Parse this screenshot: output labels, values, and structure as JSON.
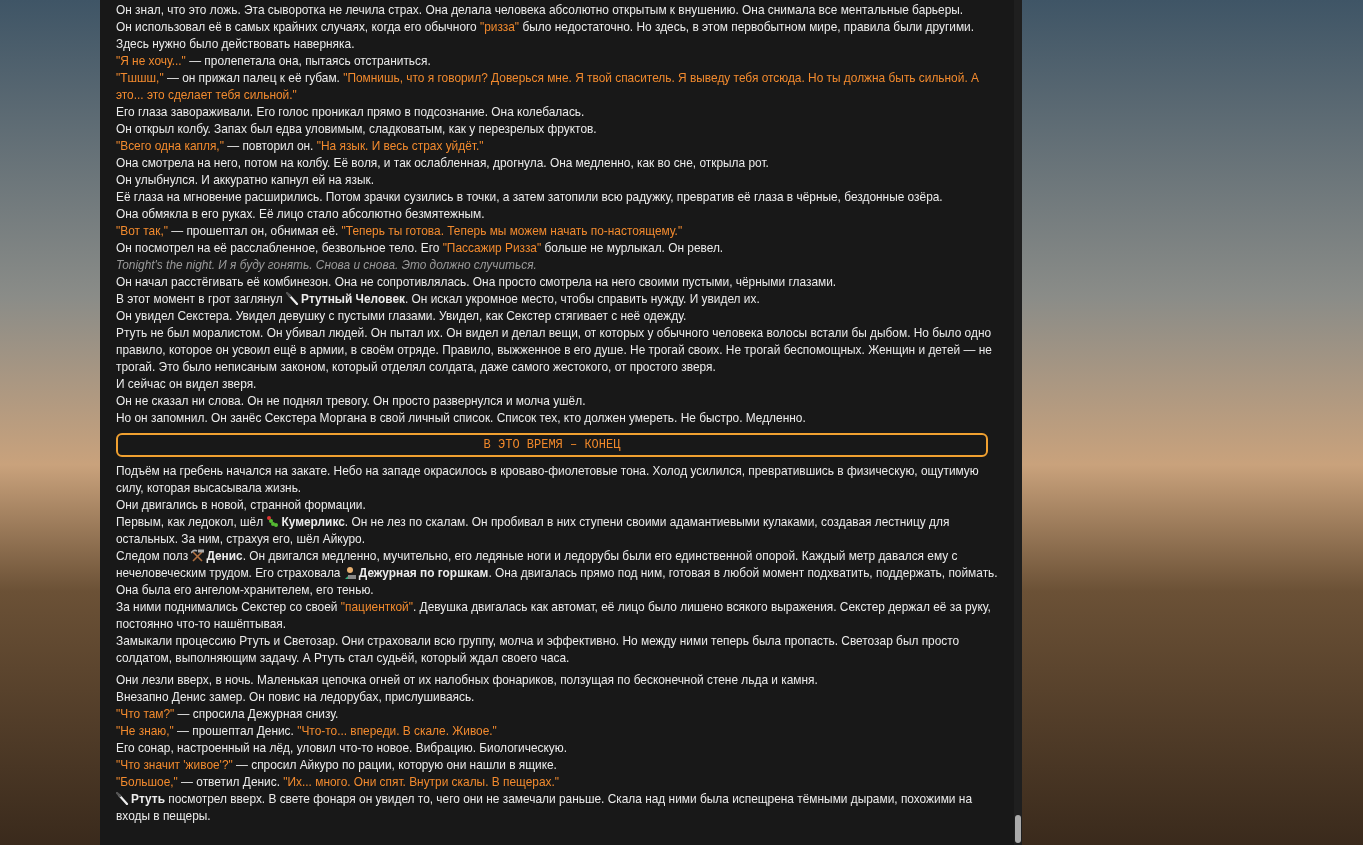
{
  "sections": [
    {
      "kind": "text",
      "paragraphs": [
        [
          {
            "kind": "text",
            "text": "Он знал, что это ложь. Эта сыворотка не лечила страх. Она делала человека абсолютно открытым к внушению. Она снимала все ментальные барьеры."
          }
        ],
        [
          {
            "kind": "text",
            "text": "Он использовал её в самых крайних случаях, когда его обычного "
          },
          {
            "kind": "quote",
            "text": "\"ризза\""
          },
          {
            "kind": "text",
            "text": " было недостаточно. Но здесь, в этом первобытном мире, правила были другими. Здесь нужно было действовать наверняка."
          }
        ],
        [
          {
            "kind": "quote",
            "text": "\"Я не хочу...\""
          },
          {
            "kind": "text",
            "text": " — пролепетала она, пытаясь отстраниться."
          }
        ],
        [
          {
            "kind": "quote",
            "text": "\"Тшшш,\""
          },
          {
            "kind": "text",
            "text": " — он прижал палец к её губам. "
          },
          {
            "kind": "quote",
            "text": "\"Помнишь, что я говорил? Доверься мне. Я твой спаситель. Я выведу тебя отсюда. Но ты должна быть сильной. А это... это сделает тебя сильной.\""
          }
        ],
        [
          {
            "kind": "text",
            "text": "Его глаза завораживали. Его голос проникал прямо в подсознание. Она колебалась."
          }
        ],
        [
          {
            "kind": "text",
            "text": "Он открыл колбу. Запах был едва уловимым, сладковатым, как у перезрелых фруктов."
          }
        ],
        [
          {
            "kind": "quote",
            "text": "\"Всего одна капля,\""
          },
          {
            "kind": "text",
            "text": " — повторил он. "
          },
          {
            "kind": "quote",
            "text": "\"На язык. И весь страх уйдёт.\""
          }
        ],
        [
          {
            "kind": "text",
            "text": "Она смотрела на него, потом на колбу. Её воля, и так ослабленная, дрогнула. Она медленно, как во сне, открыла рот."
          }
        ],
        [
          {
            "kind": "text",
            "text": "Он улыбнулся. И аккуратно капнул ей на язык."
          }
        ],
        [
          {
            "kind": "text",
            "text": "Её глаза на мгновение расширились. Потом зрачки сузились в точки, а затем затопили всю радужку, превратив её глаза в чёрные, бездонные озёра."
          }
        ],
        [
          {
            "kind": "text",
            "text": "Она обмякла в его руках. Её лицо стало абсолютно безмятежным."
          }
        ],
        [
          {
            "kind": "quote",
            "text": "\"Вот так,\""
          },
          {
            "kind": "text",
            "text": " — прошептал он, обнимая её. "
          },
          {
            "kind": "quote",
            "text": "\"Теперь ты готова. Теперь мы можем начать по-настоящему.\""
          }
        ],
        [
          {
            "kind": "text",
            "text": "Он посмотрел на её расслабленное, безвольное тело. Его "
          },
          {
            "kind": "quote",
            "text": "\"Пассажир Ризза\""
          },
          {
            "kind": "text",
            "text": " больше не мурлыкал. Он ревел."
          }
        ],
        [
          {
            "kind": "italic",
            "text": "Tonight's the night. И я буду гонять. Снова и снова. Это должно случиться."
          }
        ],
        [
          {
            "kind": "text",
            "text": "Он начал расстёгивать её комбинезон. Она не сопротивлялась. Она просто смотрела на него своими пустыми, чёрными глазами."
          }
        ],
        [
          {
            "kind": "text",
            "text": "В этот момент в грот заглянул "
          },
          {
            "kind": "name",
            "text": "Ртутный Человек"
          },
          {
            "kind": "text",
            "text": ". Он искал укромное место, чтобы справить нужду. И увидел их."
          }
        ],
        [
          {
            "kind": "text",
            "text": "Он увидел Секстера. Увидел девушку с пустыми глазами. Увидел, как Секстер стягивает с неё одежду."
          }
        ],
        [
          {
            "kind": "text",
            "text": "Ртуть не был моралистом. Он убивал людей. Он пытал их. Он видел и делал вещи, от которых у обычного человека волосы встали бы дыбом. Но было одно правило, которое он усвоил ещё в армии, в своём отряде. Правило, выжженное в его душе. Не трогай своих. Не трогай беспомощных. Женщин и детей — не трогай. Это было неписаным законом, который отделял солдата, даже самого жестокого, от простого зверя."
          }
        ],
        [
          {
            "kind": "text",
            "text": "И сейчас он видел зверя."
          }
        ],
        [
          {
            "kind": "text",
            "text": "Он не сказал ни слова. Он не поднял тревогу. Он просто развернулся и молча ушёл."
          }
        ],
        [
          {
            "kind": "text",
            "text": "Но он запомнил. Он занёс Секстера Моргана в свой личный список. Список тех, кто должен умереть. Не быстро. Медленно."
          }
        ]
      ]
    },
    {
      "kind": "divider",
      "text": "В ЭТО ВРЕМЯ – КОНЕЦ"
    },
    {
      "kind": "text",
      "paragraphs": [
        [
          {
            "kind": "text",
            "text": "Подъём на гребень начался на закате. Небо на западе окрасилось в кроваво-фиолетовые тона. Холод усилился, превратившись в физическую, ощутимую силу, которая высасывала жизнь."
          }
        ],
        [
          {
            "kind": "text",
            "text": "Они двигались в новой, странной формации."
          }
        ],
        [
          {
            "kind": "text",
            "text": "Первым, как ледокол, шёл "
          },
          {
            "kind": "name",
            "text": "Кумерликс"
          },
          {
            "kind": "text",
            "text": ". Он не лез по скалам. Он пробивал в них ступени своими адамантиевыми кулаками, создавая лестницу для остальных. За ним, страхуя его, шёл Айкуро."
          }
        ],
        [
          {
            "kind": "text",
            "text": "Следом полз "
          },
          {
            "kind": "name",
            "text": "Денис"
          },
          {
            "kind": "text",
            "text": ". Он двигался медленно, мучительно, его ледяные ноги и ледорубы были его единственной опорой. Каждый метр давался ему с нечеловеческим трудом. Его страховала "
          },
          {
            "kind": "name",
            "text": "Дежурная по горшкам"
          },
          {
            "kind": "text",
            "text": ". Она двигалась прямо под ним, готовая в любой момент подхватить, поддержать, поймать. Она была его ангелом-хранителем, его тенью."
          }
        ],
        [
          {
            "kind": "text",
            "text": "За ними поднимались Секстер со своей "
          },
          {
            "kind": "quote",
            "text": "\"пациенткой\""
          },
          {
            "kind": "text",
            "text": ". Девушка двигалась как автомат, её лицо было лишено всякого выражения. Секстер держал её за руку, постоянно что-то нашёптывая."
          }
        ],
        [
          {
            "kind": "text",
            "text": "Замыкали процессию Ртуть и Светозар. Они страховали всю группу, молча и эффективно. Но между ними теперь была пропасть. Светозар был просто солдатом, выполняющим задачу. А Ртуть стал судьёй, который ждал своего часа."
          }
        ]
      ]
    },
    {
      "kind": "text",
      "paragraphs": [
        [
          {
            "kind": "text",
            "text": "Они лезли вверх, в ночь. Маленькая цепочка огней от их налобных фонариков, ползущая по бесконечной стене льда и камня."
          }
        ],
        [
          {
            "kind": "text",
            "text": "Внезапно Денис замер. Он повис на ледорубах, прислушиваясь."
          }
        ],
        [
          {
            "kind": "quote",
            "text": "\"Что там?\""
          },
          {
            "kind": "text",
            "text": " — спросила Дежурная снизу."
          }
        ],
        [
          {
            "kind": "quote",
            "text": "\"Не знаю,\""
          },
          {
            "kind": "text",
            "text": " — прошептал Денис. "
          },
          {
            "kind": "quote",
            "text": "\"Что-то... впереди. В скале. Живое.\""
          }
        ],
        [
          {
            "kind": "text",
            "text": "Его сонар, настроенный на лёд, уловил что-то новое. Вибрацию. Биологическую."
          }
        ],
        [
          {
            "kind": "quote",
            "text": "\"Что значит 'живое'?\""
          },
          {
            "kind": "text",
            "text": " — спросил Айкуро по рации, которую они нашли в ящике."
          }
        ],
        [
          {
            "kind": "quote",
            "text": "\"Большое,\""
          },
          {
            "kind": "text",
            "text": " — ответил Денис. "
          },
          {
            "kind": "quote",
            "text": "\"Их... много. Они спят. Внутри скалы. В пещерах.\""
          }
        ],
        [
          {
            "kind": "name",
            "text": "Ртуть"
          },
          {
            "kind": "text",
            "text": " посмотрел вверх. В свете фонаря он увидел то, чего они не замечали раньше. Скала над ними была испещрена тёмными дырами, похожими на входы в пещеры."
          }
        ]
      ]
    }
  ]
}
